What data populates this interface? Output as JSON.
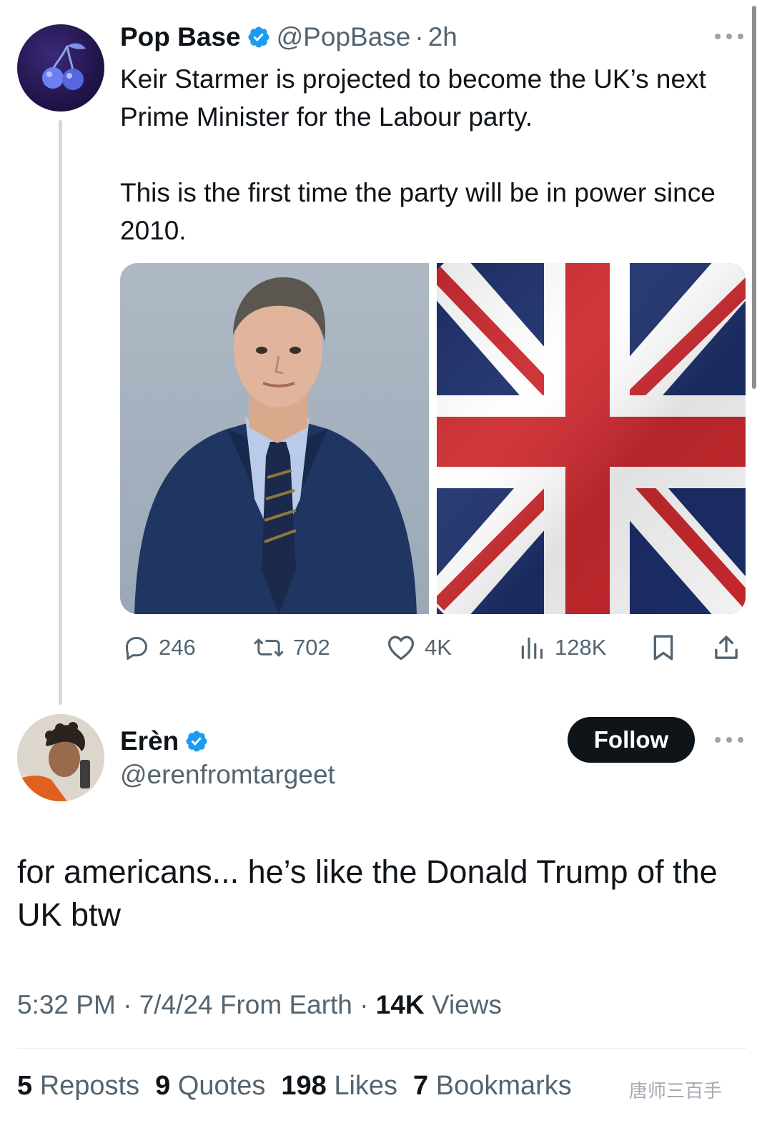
{
  "colors": {
    "verified": "#1d9bf0",
    "text": "#0f1419",
    "secondary": "#536471",
    "follow_bg": "#0f1419"
  },
  "parent_tweet": {
    "author_name": "Pop Base",
    "handle": "@PopBase",
    "separator": "·",
    "time": "2h",
    "text_p1": "Keir Starmer is projected to become the UK’s next Prime Minister for the Labour party.",
    "text_p2": "This is the first time the party will be in power since 2010.",
    "media": [
      "photo-portrait",
      "photo-union-jack-flag"
    ],
    "actions": {
      "replies": "246",
      "reposts": "702",
      "likes": "4K",
      "views": "128K"
    }
  },
  "reply": {
    "author_name": "Erèn",
    "handle": "@erenfromtargeet",
    "follow_label": "Follow",
    "text": "for americans... he’s like the Donald Trump of the UK btw",
    "meta": {
      "time": "5:32 PM",
      "dot1": "·",
      "date": "7/4/24",
      "source": "From Earth",
      "dot2": "·",
      "views_count": "14K",
      "views_label": "Views"
    },
    "stats": {
      "reposts_count": "5",
      "reposts_label": "Reposts",
      "quotes_count": "9",
      "quotes_label": "Quotes",
      "likes_count": "198",
      "likes_label": "Likes",
      "bookmarks_count": "7",
      "bookmarks_label": "Bookmarks"
    }
  },
  "watermark": "唐师三百手"
}
